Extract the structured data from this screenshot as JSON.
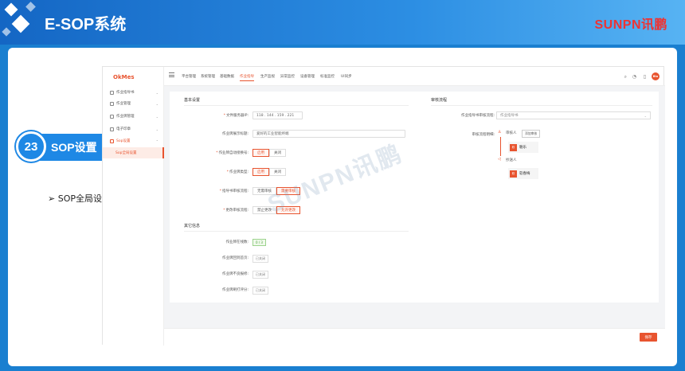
{
  "slide": {
    "title": "E-SOP系统",
    "brand": "SUNPN讯鹏",
    "badge_number": "23",
    "badge_text": "SOP设置",
    "sub_bullet": "➢ SOP全局设置",
    "watermark": "SUNPN讯鹏"
  },
  "app": {
    "logo": "OkMes",
    "sidebar": [
      {
        "label": "作业指导书",
        "chev": "⌄"
      },
      {
        "label": "作业管理",
        "chev": "⌄"
      },
      {
        "label": "作业牌管理",
        "chev": "⌄"
      },
      {
        "label": "电子印章",
        "chev": "⌄"
      },
      {
        "label": "Sop设置",
        "chev": "⌃"
      },
      {
        "label": "Sop全局设置",
        "chev": ""
      }
    ],
    "nav": [
      "平台管理",
      "系统管理",
      "基础数据",
      "作业指导",
      "生产监视",
      "异常监控",
      "设备管理",
      "标准监控",
      "UI同步"
    ],
    "avatar": "Blu",
    "basic": {
      "title": "基本设置",
      "file_server_label": "文件服务器IP:",
      "ip": [
        "118",
        "144",
        "159",
        "221"
      ],
      "page_title_label": "作业牌展示标题:",
      "page_title_value": "爱好的工业智能终端",
      "auto_switch_label": "作业牌自动接换号:",
      "auto_switch_options": [
        "启用",
        "关闭"
      ],
      "type_label": "作业牌类型:",
      "type_options": [
        "启用",
        "关闭"
      ],
      "review_flow_label": "指导书审核流程:",
      "review_flow_options": [
        "无需审核",
        "需要审核"
      ],
      "change_flow_label": "更改审核流程:",
      "change_flow_options": [
        "禁止更改",
        "允许更改"
      ]
    },
    "other": {
      "title": "其它信息",
      "rows": [
        {
          "label": "作业牌在线数:",
          "tag": "0 / 3",
          "green": true
        },
        {
          "label": "作业牌回到首页:",
          "tag": "已关闭",
          "green": false
        },
        {
          "label": "作业牌不良报修:",
          "tag": "已关闭",
          "green": false
        },
        {
          "label": "作业牌刷打评分:",
          "tag": "已关闭",
          "green": false
        }
      ]
    },
    "review": {
      "title": "审核流程",
      "select_label": "作业指导书审核流程:",
      "select_value": "作业指导书",
      "node_label": "审核流程明细:",
      "approver_label": "审核人",
      "approver_btn": "添加审核",
      "approver_avatar": "软",
      "approver_name": "駱乐",
      "cc_label": "抄送人",
      "cc_avatar": "软",
      "cc_name": "软春梅"
    },
    "save_label": "保存"
  }
}
